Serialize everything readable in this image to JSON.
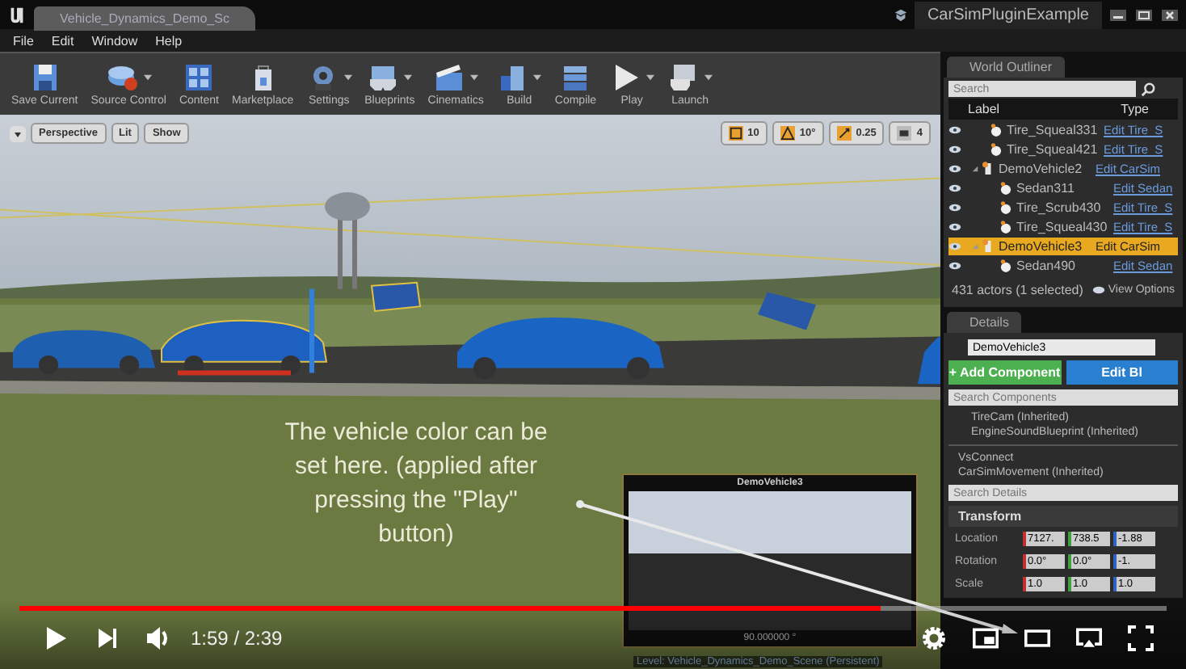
{
  "window": {
    "tab": "Vehicle_Dynamics_Demo_Sc",
    "project": "CarSimPluginExample"
  },
  "menu": [
    "File",
    "Edit",
    "Window",
    "Help"
  ],
  "toolbar": [
    {
      "label": "Save Current",
      "kind": "save",
      "dropdown": false
    },
    {
      "label": "Source Control",
      "kind": "source",
      "dropdown": true
    },
    {
      "label": "Content",
      "kind": "content",
      "dropdown": false
    },
    {
      "label": "Marketplace",
      "kind": "market",
      "dropdown": false
    },
    {
      "label": "Settings",
      "kind": "settings",
      "dropdown": true
    },
    {
      "label": "Blueprints",
      "kind": "blueprints",
      "dropdown": true
    },
    {
      "label": "Cinematics",
      "kind": "cinematics",
      "dropdown": true
    },
    {
      "label": "Build",
      "kind": "build",
      "dropdown": true
    },
    {
      "label": "Compile",
      "kind": "compile",
      "dropdown": false
    },
    {
      "label": "Play",
      "kind": "play",
      "dropdown": true
    },
    {
      "label": "Launch",
      "kind": "launch",
      "dropdown": true
    }
  ],
  "viewport_bar": {
    "view": "Perspective",
    "mode": "Lit",
    "show": "Show",
    "snaps": [
      {
        "kind": "grid",
        "value": "10",
        "on": true
      },
      {
        "kind": "rotate",
        "value": "10°",
        "on": true
      },
      {
        "kind": "scale",
        "value": "0.25",
        "on": true
      },
      {
        "kind": "camera",
        "value": "4",
        "on": false
      }
    ]
  },
  "caption": "The vehicle color can be set here. (applied after pressing the \"Play\" button)",
  "camera_preview": {
    "title": "DemoVehicle3",
    "reading": "90.000000 °"
  },
  "level_label": "Level:  Vehicle_Dynamics_Demo_Scene (Persistent)",
  "outliner": {
    "tab": "World Outliner",
    "search_placeholder": "Search",
    "columns": [
      "Label",
      "Type"
    ],
    "items": [
      {
        "label": "Tire_Squeal331",
        "type": "Edit Tire_S",
        "kind": "component",
        "selected": false
      },
      {
        "label": "Tire_Squeal421",
        "type": "Edit Tire_S",
        "kind": "component",
        "selected": false
      },
      {
        "label": "DemoVehicle2",
        "type": "Edit CarSim",
        "kind": "vehicle",
        "selected": false,
        "expanded": true,
        "children": [
          {
            "label": "Sedan311",
            "type": "Edit Sedan",
            "kind": "component",
            "selected": false
          },
          {
            "label": "Tire_Scrub430",
            "type": "Edit Tire_S",
            "kind": "component",
            "selected": false
          },
          {
            "label": "Tire_Squeal430",
            "type": "Edit Tire_S",
            "kind": "component",
            "selected": false
          }
        ]
      },
      {
        "label": "DemoVehicle3",
        "type": "Edit CarSim",
        "kind": "vehicle",
        "selected": true,
        "expanded": true,
        "children": [
          {
            "label": "Sedan490",
            "type": "Edit Sedan",
            "kind": "component",
            "selected": false
          }
        ]
      }
    ],
    "footer": "431 actors (1 selected)",
    "view_options": "View Options"
  },
  "details": {
    "tab": "Details",
    "name": "DemoVehicle3",
    "add": "+ Add Component",
    "edit": "Edit Bl",
    "components_placeholder": "Search Components",
    "inherited": [
      "TireCam (Inherited)",
      "EngineSoundBlueprint (Inherited)"
    ],
    "components": [
      "VsConnect",
      "CarSimMovement (Inherited)"
    ],
    "details_placeholder": "Search Details",
    "transform": {
      "title": "Transform",
      "rows": [
        {
          "label": "Location",
          "values": [
            "7127.",
            "738.5",
            "-1.88"
          ]
        },
        {
          "label": "Rotation",
          "values": [
            "0.0°",
            "0.0°",
            "-1."
          ]
        },
        {
          "label": "Scale",
          "values": [
            "1.0",
            "1.0",
            "1.0"
          ]
        }
      ]
    }
  },
  "player": {
    "level": 0.75,
    "time": "1:59 / 2:39"
  }
}
